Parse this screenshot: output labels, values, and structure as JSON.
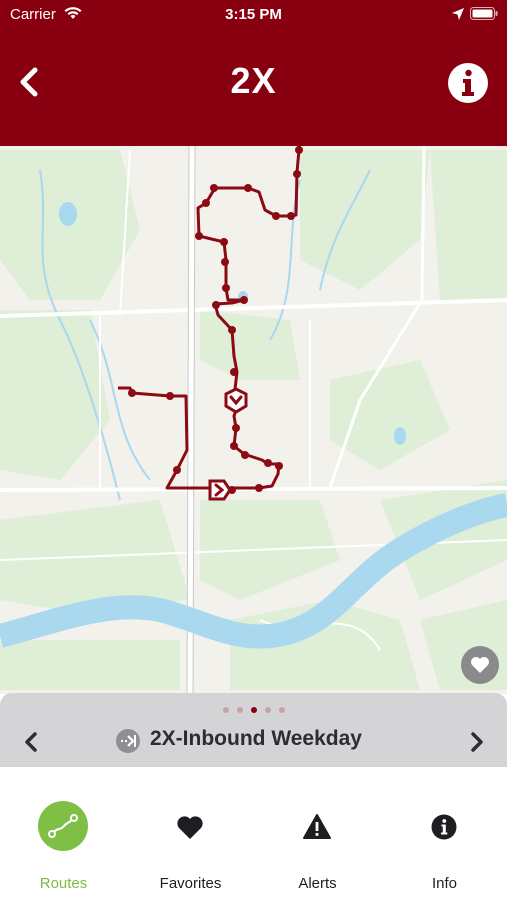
{
  "status": {
    "carrier": "Carrier",
    "time": "3:15 PM"
  },
  "header": {
    "title": "2X",
    "background_color": "#880010"
  },
  "map": {
    "route_color": "#8b0a14",
    "river_color": "#a8d8f0",
    "park_color": "#dcebd2"
  },
  "route_selector": {
    "route_name": "2X-Inbound Weekday",
    "page_count": 5,
    "active_page": 3
  },
  "tabs": [
    {
      "label": "Routes",
      "icon": "route-icon",
      "active": true
    },
    {
      "label": "Favorites",
      "icon": "heart-icon",
      "active": false
    },
    {
      "label": "Alerts",
      "icon": "alert-triangle-icon",
      "active": false
    },
    {
      "label": "Info",
      "icon": "info-icon",
      "active": false
    }
  ],
  "colors": {
    "accent": "#880010",
    "tab_active": "#7dbb3f"
  }
}
